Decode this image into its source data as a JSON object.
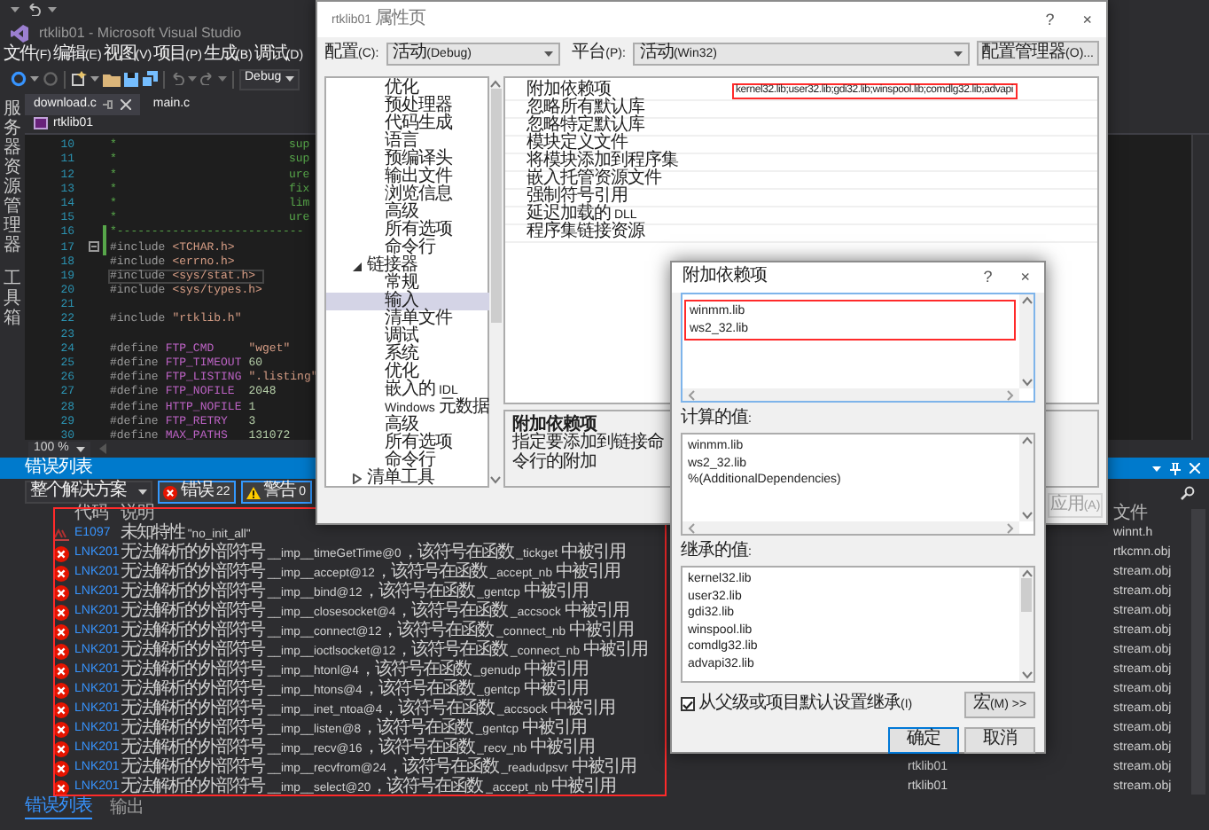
{
  "ide": {
    "title": "rtklib01 - Microsoft Visual Studio",
    "menu": [
      "文件(F)",
      "编辑(E)",
      "视图(V)",
      "项目(P)",
      "生成(B)",
      "调试(D)"
    ],
    "configuration": "Debug",
    "side_tabs": [
      "服务器资源管理器",
      "工具箱"
    ],
    "tabs": [
      {
        "label": "download.c",
        "selected": true
      },
      {
        "label": "main.c",
        "selected": false
      }
    ],
    "navigation": "rtklib01",
    "editor": {
      "zoom": "100 %",
      "lines": [
        {
          "number": "10",
          "current": false,
          "changed": false,
          "foldable": false,
          "tokens": [
            {
              "text": "*",
              "kind": "comment"
            }
          ],
          "tail": "sup"
        },
        {
          "number": "11",
          "current": false,
          "changed": false,
          "foldable": false,
          "tokens": [
            {
              "text": "*",
              "kind": "comment"
            }
          ],
          "tail": "sup"
        },
        {
          "number": "12",
          "current": false,
          "changed": false,
          "foldable": false,
          "tokens": [
            {
              "text": "*",
              "kind": "comment"
            }
          ],
          "tail": "ure"
        },
        {
          "number": "13",
          "current": false,
          "changed": false,
          "foldable": false,
          "tokens": [
            {
              "text": "*",
              "kind": "comment"
            }
          ],
          "tail": "fix"
        },
        {
          "number": "14",
          "current": false,
          "changed": false,
          "foldable": false,
          "tokens": [
            {
              "text": "*",
              "kind": "comment"
            }
          ],
          "tail": "lim"
        },
        {
          "number": "15",
          "current": false,
          "changed": false,
          "foldable": false,
          "tokens": [
            {
              "text": "*",
              "kind": "comment"
            }
          ],
          "tail": "ure"
        },
        {
          "number": "16",
          "current": false,
          "changed": true,
          "foldable": false,
          "tokens": [
            {
              "text": "*---------------------------",
              "kind": "comment"
            }
          ]
        },
        {
          "number": "17",
          "current": false,
          "changed": true,
          "foldable": true,
          "tokens": [
            {
              "text": "#include",
              "kind": "pp"
            },
            {
              "text": "<TCHAR.h>",
              "kind": "hdr"
            }
          ]
        },
        {
          "number": "18",
          "current": false,
          "changed": false,
          "foldable": false,
          "tokens": [
            {
              "text": "#include",
              "kind": "pp"
            },
            {
              "text": "<errno.h>",
              "kind": "hdr"
            }
          ]
        },
        {
          "number": "19",
          "current": true,
          "changed": false,
          "foldable": false,
          "tokens": [
            {
              "text": "#include",
              "kind": "pp"
            },
            {
              "text": "<sys/stat.h>",
              "kind": "hdr"
            }
          ]
        },
        {
          "number": "20",
          "current": false,
          "changed": false,
          "foldable": false,
          "tokens": [
            {
              "text": "#include",
              "kind": "pp"
            },
            {
              "text": "<sys/types.h>",
              "kind": "hdr"
            }
          ]
        },
        {
          "number": "21",
          "current": false,
          "changed": false,
          "foldable": false
        },
        {
          "number": "22",
          "current": false,
          "changed": false,
          "foldable": false,
          "tokens": [
            {
              "text": "#include",
              "kind": "pp"
            },
            {
              "text": "\"rtklib.h\"",
              "kind": "str"
            }
          ]
        },
        {
          "number": "23",
          "current": false,
          "changed": false,
          "foldable": false
        },
        {
          "number": "24",
          "current": false,
          "changed": false,
          "foldable": false,
          "tokens": [
            {
              "text": "#define",
              "kind": "pp"
            },
            {
              "text": "FTP_CMD",
              "kind": "macro"
            },
            {
              "text": "\"wget\"",
              "kind": "str"
            }
          ]
        },
        {
          "number": "25",
          "current": false,
          "changed": false,
          "foldable": false,
          "tokens": [
            {
              "text": "#define",
              "kind": "pp"
            },
            {
              "text": "FTP_TIMEOUT",
              "kind": "macro"
            },
            {
              "text": "60",
              "kind": "num"
            }
          ]
        },
        {
          "number": "26",
          "current": false,
          "changed": false,
          "foldable": false,
          "tokens": [
            {
              "text": "#define",
              "kind": "pp"
            },
            {
              "text": "FTP_LISTING",
              "kind": "macro"
            },
            {
              "text": "\".listing\"",
              "kind": "str"
            }
          ]
        },
        {
          "number": "27",
          "current": false,
          "changed": false,
          "foldable": false,
          "tokens": [
            {
              "text": "#define",
              "kind": "pp"
            },
            {
              "text": "FTP_NOFILE",
              "kind": "macro"
            },
            {
              "text": "2048",
              "kind": "num"
            }
          ]
        },
        {
          "number": "28",
          "current": false,
          "changed": false,
          "foldable": false,
          "tokens": [
            {
              "text": "#define",
              "kind": "pp"
            },
            {
              "text": "HTTP_NOFILE",
              "kind": "macro"
            },
            {
              "text": "1",
              "kind": "num"
            }
          ]
        },
        {
          "number": "29",
          "current": false,
          "changed": false,
          "foldable": false,
          "tokens": [
            {
              "text": "#define",
              "kind": "pp"
            },
            {
              "text": "FTP_RETRY",
              "kind": "macro"
            },
            {
              "text": "3",
              "kind": "num"
            }
          ]
        },
        {
          "number": "30",
          "current": false,
          "changed": false,
          "foldable": false,
          "tokens": [
            {
              "text": "#define",
              "kind": "pp"
            },
            {
              "text": "MAX_PATHS",
              "kind": "macro"
            },
            {
              "text": "131072",
              "kind": "num"
            }
          ]
        }
      ]
    }
  },
  "error_list": {
    "title": "错误列表",
    "scope": "整个解决方案",
    "errors_button": {
      "label": "错误 22",
      "selected": true
    },
    "warnings_button": {
      "label": "警告 0",
      "selected": true
    },
    "columns": {
      "code": "代码",
      "description": "说明",
      "file": "文件"
    },
    "rows": [
      {
        "kind": "intellisense",
        "code": "E1097",
        "description": "未知特性 \"no_init_all\"",
        "file": "winnt.h"
      },
      {
        "kind": "error",
        "code": "LNK201",
        "description": "无法解析的外部符号 __imp__timeGetTime@0，该符号在函数 _tickget 中被引用",
        "file": "rtkcmn.obj"
      },
      {
        "kind": "error",
        "code": "LNK201",
        "description": "无法解析的外部符号 __imp__accept@12，该符号在函数 _accept_nb 中被引用",
        "file": "stream.obj"
      },
      {
        "kind": "error",
        "code": "LNK201",
        "description": "无法解析的外部符号 __imp__bind@12，该符号在函数 _gentcp 中被引用",
        "file": "stream.obj"
      },
      {
        "kind": "error",
        "code": "LNK201",
        "description": "无法解析的外部符号 __imp__closesocket@4，该符号在函数 _accsock 中被引用",
        "file": "stream.obj"
      },
      {
        "kind": "error",
        "code": "LNK201",
        "description": "无法解析的外部符号 __imp__connect@12，该符号在函数 _connect_nb 中被引用",
        "file": "stream.obj"
      },
      {
        "kind": "error",
        "code": "LNK201",
        "description": "无法解析的外部符号 __imp__ioctlsocket@12，该符号在函数 _connect_nb 中被引用",
        "file": "stream.obj"
      },
      {
        "kind": "error",
        "code": "LNK201",
        "description": "无法解析的外部符号 __imp__htonl@4，该符号在函数 _genudp 中被引用",
        "file": "stream.obj"
      },
      {
        "kind": "error",
        "code": "LNK201",
        "description": "无法解析的外部符号 __imp__htons@4，该符号在函数 _gentcp 中被引用",
        "file": "stream.obj"
      },
      {
        "kind": "error",
        "code": "LNK201",
        "description": "无法解析的外部符号 __imp__inet_ntoa@4，该符号在函数 _accsock 中被引用",
        "file": "stream.obj"
      },
      {
        "kind": "error",
        "code": "LNK201",
        "description": "无法解析的外部符号 __imp__listen@8，该符号在函数 _gentcp 中被引用",
        "file": "stream.obj"
      },
      {
        "kind": "error",
        "code": "LNK201",
        "description": "无法解析的外部符号 __imp__recv@16，该符号在函数 _recv_nb 中被引用",
        "file": "stream.obj"
      },
      {
        "kind": "error",
        "code": "LNK201",
        "description": "无法解析的外部符号 __imp__recvfrom@24，该符号在函数 _readudpsvr 中被引用",
        "project": "rtklib01",
        "file": "stream.obj"
      },
      {
        "kind": "error",
        "code": "LNK201",
        "description": "无法解析的外部符号 __imp__select@20，该符号在函数 _accept_nb 中被引用",
        "project": "rtklib01",
        "file": "stream.obj"
      }
    ],
    "bottom_tabs": [
      {
        "label": "错误列表",
        "selected": true
      },
      {
        "label": "输出",
        "selected": false
      }
    ]
  },
  "property_dialog": {
    "title": "rtklib01 属性页",
    "help": "?",
    "close": "×",
    "config_label": "配置(C):",
    "config_value": "活动(Debug)",
    "platform_label": "平台(P):",
    "platform_value": "活动(Win32)",
    "manager_button": "配置管理器(O)...",
    "tree": [
      {
        "children": [
          {
            "label": "优化",
            "selected": false
          },
          {
            "label": "预处理器",
            "selected": false
          },
          {
            "label": "代码生成",
            "selected": false
          },
          {
            "label": "语言",
            "selected": false
          },
          {
            "label": "预编译头",
            "selected": false
          },
          {
            "label": "输出文件",
            "selected": false
          },
          {
            "label": "浏览信息",
            "selected": false
          },
          {
            "label": "高级",
            "selected": false
          },
          {
            "label": "所有选项",
            "selected": false
          },
          {
            "label": "命令行",
            "selected": false
          }
        ]
      },
      {
        "label": "链接器",
        "selected": false,
        "expanded": true,
        "children": [
          {
            "label": "常规",
            "selected": false
          },
          {
            "label": "输入",
            "selected": true
          },
          {
            "label": "清单文件",
            "selected": false
          },
          {
            "label": "调试",
            "selected": false
          },
          {
            "label": "系统",
            "selected": false
          },
          {
            "label": "优化",
            "selected": false
          },
          {
            "label": "嵌入的 IDL",
            "selected": false
          },
          {
            "label": "Windows 元数据",
            "selected": false
          },
          {
            "label": "高级",
            "selected": false
          },
          {
            "label": "所有选项",
            "selected": false
          },
          {
            "label": "命令行",
            "selected": false
          }
        ]
      },
      {
        "label": "清单工具",
        "selected": false,
        "expanded": false
      }
    ],
    "properties": [
      {
        "name": "附加依赖项",
        "value": "kernel32.lib;user32.lib;gdi32.lib;winspool.lib;comdlg32.lib;advapi"
      },
      {
        "name": "忽略所有默认库"
      },
      {
        "name": "忽略特定默认库"
      },
      {
        "name": "模块定义文件"
      },
      {
        "name": "将模块添加到程序集"
      },
      {
        "name": "嵌入托管资源文件"
      },
      {
        "name": "强制符号引用"
      },
      {
        "name": "延迟加载的 DLL"
      },
      {
        "name": "程序集链接资源"
      }
    ],
    "description_title": "附加依赖项",
    "description": "指定要添加到链接命令行的附加",
    "apply_button": {
      "label": "应用(A)",
      "disabled": true
    }
  },
  "dependencies_dialog": {
    "title": "附加依赖项",
    "help": "?",
    "close": "×",
    "entries": [
      "winmm.lib",
      "ws2_32.lib"
    ],
    "evaluated_label": "计算的值:",
    "evaluated": [
      "winmm.lib",
      "ws2_32.lib",
      "%(AdditionalDependencies)"
    ],
    "inherited_label": "继承的值:",
    "inherited": [
      "kernel32.lib",
      "user32.lib",
      "gdi32.lib",
      "winspool.lib",
      "comdlg32.lib",
      "advapi32.lib"
    ],
    "inherit_checkbox": {
      "label": "从父级或项目默认设置继承(I)",
      "checked": true
    },
    "macros_button": "宏(M) >>",
    "ok_button": "确定",
    "cancel_button": "取消"
  }
}
